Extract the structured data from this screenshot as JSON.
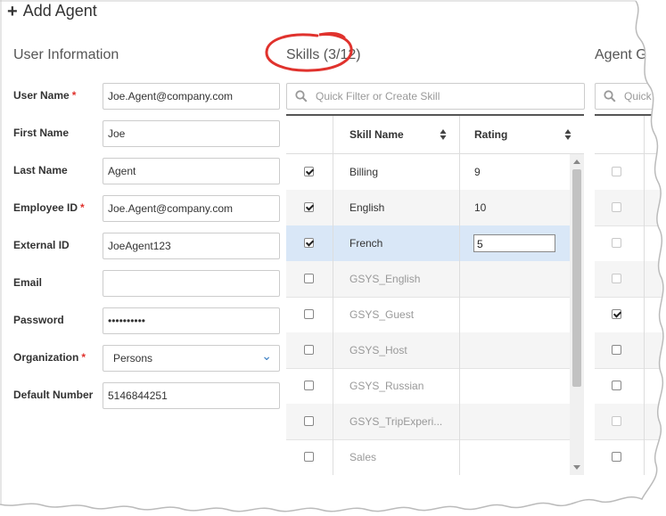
{
  "header": {
    "title": "Add Agent",
    "icon": "plus-icon"
  },
  "user_info": {
    "heading": "User Information",
    "fields": [
      {
        "label": "User Name",
        "required": true,
        "value": "Joe.Agent@company.com"
      },
      {
        "label": "First Name",
        "required": false,
        "value": "Joe"
      },
      {
        "label": "Last Name",
        "required": false,
        "value": "Agent"
      },
      {
        "label": "Employee ID",
        "required": true,
        "value": "Joe.Agent@company.com"
      },
      {
        "label": "External ID",
        "required": false,
        "value": "JoeAgent123"
      },
      {
        "label": "Email",
        "required": false,
        "value": ""
      },
      {
        "label": "Password",
        "required": false,
        "value": "••••••••••"
      },
      {
        "label": "Organization",
        "required": true,
        "value": "Persons",
        "type": "select"
      },
      {
        "label": "Default Number",
        "required": false,
        "value": "5146844251"
      }
    ],
    "required_marker": "*"
  },
  "skills": {
    "heading": "Skills (3/12)",
    "search_placeholder": "Quick Filter or Create Skill",
    "columns": {
      "name": "Skill Name",
      "rating": "Rating"
    },
    "rows": [
      {
        "name": "Billing",
        "checked": true,
        "rating": "9"
      },
      {
        "name": "English",
        "checked": true,
        "rating": "10"
      },
      {
        "name": "French",
        "checked": true,
        "rating": "5",
        "editing": true,
        "selected": true
      },
      {
        "name": "GSYS_English",
        "checked": false,
        "rating": ""
      },
      {
        "name": "GSYS_Guest",
        "checked": false,
        "rating": ""
      },
      {
        "name": "GSYS_Host",
        "checked": false,
        "rating": ""
      },
      {
        "name": "GSYS_Russian",
        "checked": false,
        "rating": ""
      },
      {
        "name": "GSYS_TripExperi...",
        "checked": false,
        "rating": ""
      },
      {
        "name": "Sales",
        "checked": false,
        "rating": ""
      }
    ]
  },
  "agent_groups": {
    "heading": "Agent Gro",
    "search_placeholder": "Quick",
    "rows": [
      {
        "checked": false,
        "dim": true
      },
      {
        "checked": false,
        "dim": true
      },
      {
        "checked": false,
        "dim": true
      },
      {
        "checked": false,
        "dim": true
      },
      {
        "checked": true,
        "dim": false
      },
      {
        "checked": false,
        "dim": false
      },
      {
        "checked": false,
        "dim": false
      },
      {
        "checked": false,
        "dim": true
      },
      {
        "checked": false,
        "dim": false
      }
    ]
  },
  "colors": {
    "accent": "#3b7fc4",
    "required": "#e0322d",
    "selected_row": "#d9e7f7",
    "annotation": "#e0322d"
  }
}
